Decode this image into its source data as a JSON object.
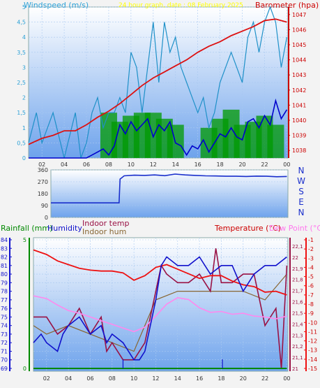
{
  "subtitle": "24 hour graph, date : 08 February 2025",
  "colors": {
    "wind_axis_label": "#2aa0d6",
    "baro_label": "#cc0000",
    "subtitle": "#ffff00",
    "panel_top": "#ffffff",
    "panel_bottom": "#6ea3ec"
  },
  "chart_data": [
    {
      "type": "line",
      "name": "wind-baro",
      "ylabel_left": "Windspeed (m/s)",
      "ylabel_right": "Barometer (hpa)",
      "x_ticks": [
        "02",
        "04",
        "06",
        "08",
        "10",
        "12",
        "14",
        "16",
        "18",
        "20",
        "22",
        "00"
      ],
      "y_left_ticks": [
        "0",
        "0,5",
        "1",
        "1,5",
        "2",
        "2,5",
        "3",
        "3,5",
        "4",
        "4,5",
        "5"
      ],
      "y_left_range": [
        0,
        5
      ],
      "y_right_ticks": [
        "1038",
        "1039",
        "1040",
        "1041",
        "1042",
        "1043",
        "1044",
        "1045",
        "1046",
        "1047"
      ],
      "y_right_range": [
        1037.5,
        1047.5
      ],
      "x_range": [
        0.8,
        24.1
      ],
      "series": [
        {
          "name": "Barometer",
          "color": "#dd1111",
          "x": [
            0.8,
            2,
            3,
            4,
            5,
            6,
            7,
            8,
            9,
            10,
            11,
            12,
            13,
            14,
            15,
            16,
            17,
            18,
            19,
            20,
            21,
            22,
            23,
            24
          ],
          "y": [
            1038.4,
            1038.8,
            1039.0,
            1039.3,
            1039.3,
            1039.7,
            1040.2,
            1040.6,
            1041.1,
            1041.7,
            1042.3,
            1042.8,
            1043.2,
            1043.6,
            1044.0,
            1044.5,
            1044.9,
            1045.2,
            1045.6,
            1045.9,
            1046.2,
            1046.6,
            1046.7,
            1046.5
          ]
        },
        {
          "name": "Gust",
          "color": "#1e90c8",
          "x": [
            0.8,
            1.5,
            2,
            3,
            4,
            5,
            5.5,
            6,
            6.5,
            7,
            7.5,
            8,
            8.5,
            9,
            9.5,
            10,
            10.5,
            11,
            11.5,
            12,
            12.5,
            13,
            13.5,
            14,
            14.5,
            15,
            15.5,
            16,
            16.5,
            17,
            17.5,
            18,
            18.5,
            19,
            19.5,
            20,
            20.5,
            21,
            21.5,
            22,
            22.5,
            23,
            23.5,
            24
          ],
          "y": [
            0.5,
            1.5,
            0.5,
            1.5,
            0,
            1.5,
            0,
            0.5,
            1.5,
            2,
            1,
            1.5,
            1.5,
            2,
            1.5,
            3.5,
            3,
            1.5,
            3,
            4.5,
            2.5,
            4.5,
            3.5,
            4,
            3,
            2.5,
            2,
            1.5,
            2,
            1,
            1.5,
            2.5,
            3,
            3.5,
            3,
            2.5,
            4,
            4.5,
            3.5,
            4.5,
            5,
            4.5,
            3,
            4
          ]
        },
        {
          "name": "Average wind",
          "color": "#0000cc",
          "x": [
            0.8,
            2,
            3,
            4,
            5,
            6,
            7,
            7.5,
            8,
            8.5,
            9,
            9.5,
            10,
            10.5,
            11,
            11.5,
            12,
            12.5,
            13,
            13.5,
            14,
            14.5,
            15,
            15.5,
            16,
            16.5,
            17,
            17.5,
            18,
            18.5,
            19,
            19.5,
            20,
            20.5,
            21,
            21.5,
            22,
            22.5,
            23,
            23.5,
            24
          ],
          "y": [
            0,
            0,
            0,
            0,
            0,
            0,
            0.2,
            0.3,
            0.1,
            0.4,
            1.1,
            0.8,
            1.2,
            0.9,
            1.1,
            1.3,
            0.7,
            1.1,
            0.9,
            1.2,
            0.5,
            0.4,
            0.1,
            0.4,
            0.3,
            0.6,
            0.2,
            0.5,
            0.8,
            0.7,
            1.0,
            0.7,
            0.6,
            1.2,
            1.3,
            1.0,
            1.4,
            1.1,
            1.9,
            1.3,
            1.6
          ]
        },
        {
          "name": "Wind direction bars",
          "color": "#008800",
          "x": [
            8,
            9,
            10,
            11,
            12,
            13,
            14,
            17,
            18,
            19,
            20,
            21,
            22,
            23
          ],
          "y": [
            1.5,
            1.2,
            1.4,
            1.5,
            1.5,
            1.3,
            1.1,
            1.0,
            1.3,
            1.6,
            1.1,
            1.2,
            1.4,
            1.1
          ]
        }
      ]
    },
    {
      "type": "line",
      "name": "wind-direction",
      "y_ticks": [
        "360",
        "270",
        "180",
        "90",
        "0"
      ],
      "y_range": [
        0,
        360
      ],
      "compass": [
        "N",
        "W",
        "S",
        "E",
        "N"
      ],
      "series": [
        {
          "name": "Direction",
          "color": "#1a2fcc",
          "x": [
            0.8,
            7.5,
            7.6,
            8,
            9,
            10,
            11,
            12,
            13,
            14,
            15,
            16,
            17,
            18,
            19,
            20,
            21,
            22,
            23,
            24
          ],
          "y": [
            110,
            110,
            290,
            315,
            320,
            318,
            322,
            316,
            328,
            322,
            318,
            315,
            314,
            312,
            312,
            310,
            313,
            312,
            308,
            310
          ]
        }
      ]
    },
    {
      "type": "line",
      "name": "temperature-humidity",
      "labels": {
        "rainfall": "Rainfall (mm)",
        "humidity": "Humidity",
        "indoor_temp": "Indoor temp",
        "indoor_hum": "Indoor hum",
        "temperature": "Temperature (°C)",
        "dew_point": "Dew Point (°C)"
      },
      "x_ticks": [
        "02",
        "04",
        "06",
        "08",
        "10",
        "12",
        "14",
        "16",
        "18",
        "20",
        "22",
        "00"
      ],
      "hum_ticks": [
        "84",
        "83",
        "82",
        "81",
        "80",
        "79",
        "78",
        "77",
        "76",
        "75",
        "74",
        "73",
        "72",
        "71",
        "70",
        "69"
      ],
      "hum_range": [
        69,
        84
      ],
      "rain_ticks": [
        "5",
        "0"
      ],
      "indoor_ticks": [
        "22,1",
        "22",
        "21,9",
        "21,8",
        "21,7",
        "21,6",
        "21,5",
        "21,4",
        "21,3",
        "21,2",
        "21,1",
        "21"
      ],
      "temp_ticks": [
        "-1",
        "-2",
        "-3",
        "-4",
        "-5",
        "-6",
        "-7",
        "-8",
        "-9",
        "-10",
        "-11",
        "-12",
        "-13",
        "-14",
        "-15"
      ],
      "temp_range": [
        -15,
        -1
      ],
      "series": [
        {
          "name": "Temperature",
          "color": "#ee1111",
          "axis": "temp",
          "x": [
            0.8,
            2,
            3,
            4,
            5,
            6,
            7,
            8,
            9,
            10,
            11,
            12,
            13,
            14,
            15,
            16,
            17,
            18,
            19,
            20,
            21,
            22,
            23,
            24
          ],
          "y": [
            -2.1,
            -2.6,
            -3.3,
            -3.7,
            -4.1,
            -4.3,
            -4.4,
            -4.4,
            -4.6,
            -5.4,
            -4.9,
            -4.0,
            -3.7,
            -4.2,
            -4.7,
            -5.2,
            -4.9,
            -4.9,
            -5.5,
            -5.9,
            -6.1,
            -6.7,
            -6.6,
            -7.0
          ]
        },
        {
          "name": "Dew Point",
          "color": "#ff88ee",
          "axis": "temp",
          "x": [
            0.8,
            2,
            3,
            4,
            5,
            6,
            7,
            8,
            9,
            10,
            11,
            12,
            13,
            14,
            15,
            16,
            17,
            18,
            19,
            20,
            21,
            22,
            23,
            24
          ],
          "y": [
            -7.1,
            -7.4,
            -8.1,
            -8.7,
            -9.0,
            -9.4,
            -9.8,
            -10.2,
            -10.6,
            -11.0,
            -10.5,
            -9.3,
            -8.0,
            -7.3,
            -7.5,
            -8.4,
            -8.9,
            -8.8,
            -9.1,
            -9.0,
            -9.3,
            -9.4,
            -9.6,
            -9.3
          ]
        },
        {
          "name": "Humidity",
          "color": "#1111cc",
          "axis": "hum",
          "x": [
            0.8,
            1.5,
            2,
            3,
            3.5,
            4,
            5,
            6,
            7,
            7.5,
            8,
            9,
            10,
            10.5,
            11,
            12,
            12.5,
            13,
            14,
            15,
            16,
            17,
            18,
            19,
            20,
            21,
            22,
            23,
            24
          ],
          "y": [
            72,
            73,
            72,
            71,
            73,
            74,
            75,
            73,
            74,
            72,
            73,
            72,
            70,
            70,
            71,
            77,
            81,
            82,
            81,
            81,
            82,
            80,
            81,
            81,
            78,
            80,
            81,
            81,
            82
          ]
        },
        {
          "name": "Indoor temp",
          "color": "#991144",
          "axis": "hum",
          "x": [
            0.8,
            2,
            3,
            4,
            5,
            6,
            7,
            7.5,
            8,
            9,
            10,
            11,
            12,
            12.5,
            13,
            14,
            15,
            16,
            17,
            17.5,
            18,
            19,
            20,
            21,
            22,
            23,
            23.5,
            24
          ],
          "y": [
            75,
            75,
            73,
            74,
            76,
            73,
            75,
            71,
            72,
            70,
            70,
            72,
            78,
            81,
            80,
            79,
            79,
            80,
            78,
            83,
            79,
            79,
            80,
            80,
            74,
            76,
            69,
            81
          ]
        },
        {
          "name": "Indoor hum",
          "color": "#886633",
          "axis": "hum",
          "x": [
            0.8,
            2,
            4,
            6,
            8,
            10,
            12,
            14,
            16,
            18,
            20,
            22,
            24
          ],
          "y": [
            74,
            73,
            74,
            73,
            72,
            71,
            77,
            78,
            78,
            78,
            78,
            77,
            80
          ]
        },
        {
          "name": "Rainfall",
          "color": "#008800",
          "axis": "rain",
          "x": [
            0.8,
            24
          ],
          "y": [
            0,
            0
          ]
        }
      ]
    }
  ]
}
